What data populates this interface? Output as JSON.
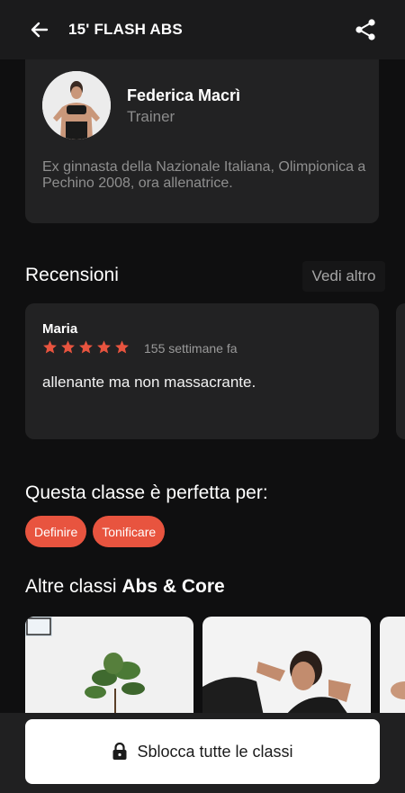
{
  "header": {
    "title": "15' FLASH ABS"
  },
  "trainer": {
    "name": "Federica Macrì",
    "role": "Trainer",
    "bio": "Ex ginnasta della Nazionale Italiana, Olimpionica a Pechino 2008, ora allenatrice."
  },
  "reviews": {
    "title": "Recensioni",
    "see_more": "Vedi altro",
    "items": [
      {
        "user": "Maria",
        "rating": 5,
        "time": "155 settimane fa",
        "text": "allenante ma non massacrante."
      }
    ]
  },
  "suited_for": {
    "title": "Questa classe è perfetta per:",
    "tags": [
      "Definire",
      "Tonificare"
    ]
  },
  "other_classes": {
    "title_prefix": "Altre classi ",
    "title_category": "Abs & Core"
  },
  "cta": {
    "label": "Sblocca tutte le classi"
  },
  "colors": {
    "accent": "#e8543f",
    "background": "#0f0f10",
    "card": "#222223"
  }
}
